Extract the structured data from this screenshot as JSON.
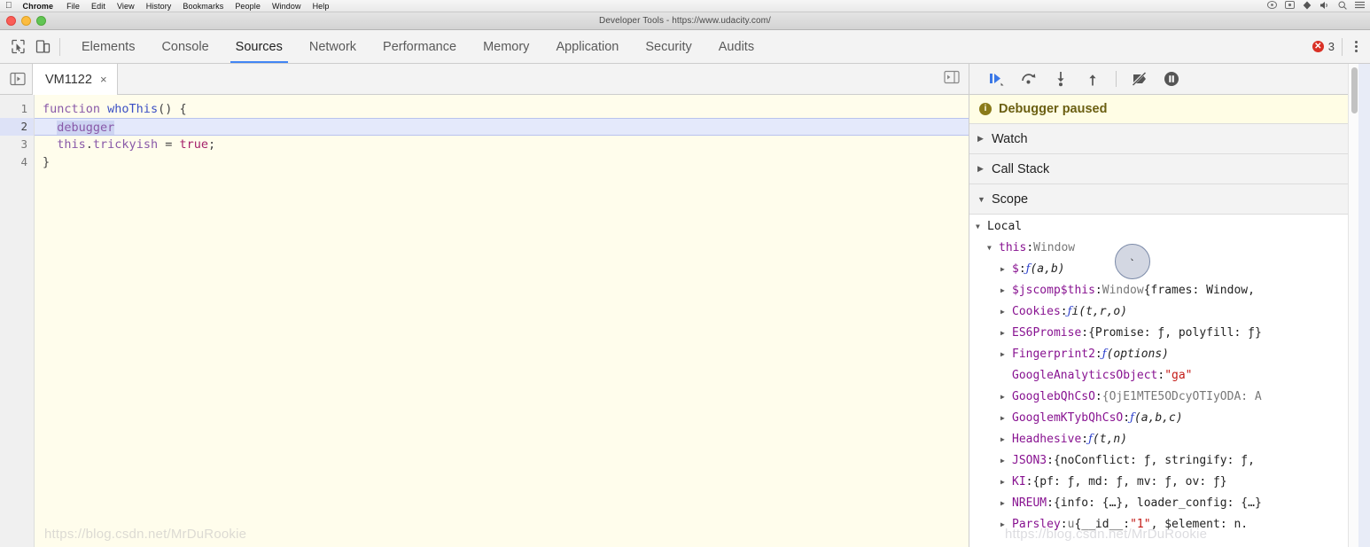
{
  "mac_menubar": {
    "apple": "apple-logo",
    "items": [
      "Chrome",
      "File",
      "Edit",
      "View",
      "History",
      "Bookmarks",
      "People",
      "Window",
      "Help"
    ],
    "status_icons": [
      "screen-share-icon",
      "screen-record-icon",
      "dropbox-icon",
      "volume-icon",
      "search-icon",
      "control-center-icon"
    ]
  },
  "window": {
    "title": "Developer Tools - https://www.udacity.com/"
  },
  "devtools": {
    "inspect_icon": "inspect-element-icon",
    "device_icon": "device-toolbar-icon",
    "tabs": [
      {
        "label": "Elements",
        "active": false
      },
      {
        "label": "Console",
        "active": false
      },
      {
        "label": "Sources",
        "active": true
      },
      {
        "label": "Network",
        "active": false
      },
      {
        "label": "Performance",
        "active": false
      },
      {
        "label": "Memory",
        "active": false
      },
      {
        "label": "Application",
        "active": false
      },
      {
        "label": "Security",
        "active": false
      },
      {
        "label": "Audits",
        "active": false
      }
    ],
    "error_count": "3",
    "error_icon": "error-circle-icon",
    "menu_icon": "kebab-menu-icon",
    "accent_color": "#4285f4",
    "error_color": "#d93025"
  },
  "editor": {
    "nav_toggle_icon": "show-navigator-icon",
    "panel_toggle_icon": "show-debugger-icon",
    "tab": {
      "name": "VM1122",
      "close": "×"
    },
    "line_numbers": [
      "1",
      "2",
      "3",
      "4"
    ],
    "code": {
      "l1_kw": "function",
      "l1_fn": "whoThis",
      "l1_pun": "() {",
      "l2_debugger": "debugger",
      "l3_this": "this",
      "l3_dot": ".",
      "l3_prop": "trickyish",
      "l3_eq": " = ",
      "l3_bool": "true",
      "l3_semi": ";",
      "l4": "}"
    },
    "highlighted_line": "2",
    "background_color": "#fffdec",
    "highlight_color": "#e4e9fb"
  },
  "debugger": {
    "controls": [
      {
        "name": "resume-script-execution",
        "icon": "resume-icon"
      },
      {
        "name": "step-over-next-function-call",
        "icon": "step-over-icon"
      },
      {
        "name": "step-into-next-function-call",
        "icon": "step-into-icon"
      },
      {
        "name": "step-out-of-current-function",
        "icon": "step-out-icon"
      },
      {
        "name": "deactivate-breakpoints",
        "icon": "deactivate-breakpoints-icon"
      },
      {
        "name": "pause-on-exceptions",
        "icon": "pause-on-exceptions-icon"
      }
    ],
    "paused_banner": {
      "icon": "info-icon",
      "text": "Debugger paused"
    },
    "sections": [
      {
        "label": "Watch",
        "expanded": false
      },
      {
        "label": "Call Stack",
        "expanded": false
      },
      {
        "label": "Scope",
        "expanded": true
      }
    ],
    "scope": {
      "local_label": "Local",
      "this_name": "this",
      "this_value": "Window",
      "rows": [
        {
          "arrow": true,
          "name": "$",
          "sep": ": ",
          "fn": "ƒ",
          "args": " (a,b)",
          "val": "",
          "str": ""
        },
        {
          "arrow": true,
          "name": "$jscomp$this",
          "sep": ": ",
          "fn": "",
          "args": "",
          "val": "Window ",
          "txt": "{frames: Window,",
          "str": ""
        },
        {
          "arrow": true,
          "name": "Cookies",
          "sep": ": ",
          "fn": "ƒ",
          "args": " i(t,r,o)",
          "val": "",
          "str": ""
        },
        {
          "arrow": true,
          "name": "ES6Promise",
          "sep": ": ",
          "fn": "",
          "args": "",
          "txt": "{Promise: ƒ, polyfill: ƒ}",
          "str": ""
        },
        {
          "arrow": true,
          "name": "Fingerprint2",
          "sep": ": ",
          "fn": "ƒ",
          "args": " (options)",
          "val": "",
          "str": ""
        },
        {
          "arrow": false,
          "name": "GoogleAnalyticsObject",
          "sep": ": ",
          "fn": "",
          "args": "",
          "str": "\"ga\""
        },
        {
          "arrow": true,
          "name": "GooglebQhCsO",
          "sep": ": ",
          "fn": "",
          "args": "",
          "val": "{OjE1MTE5ODcyOTIyODA: A",
          "str": ""
        },
        {
          "arrow": true,
          "name": "GooglemKTybQhCsO",
          "sep": ": ",
          "fn": "ƒ",
          "args": " (a,b,c)",
          "val": "",
          "str": ""
        },
        {
          "arrow": true,
          "name": "Headhesive",
          "sep": ": ",
          "fn": "ƒ",
          "args": " (t,n)",
          "val": "",
          "str": ""
        },
        {
          "arrow": true,
          "name": "JSON3",
          "sep": ": ",
          "fn": "",
          "args": "",
          "txt": "{noConflict: ƒ, stringify: ƒ,",
          "str": ""
        },
        {
          "arrow": true,
          "name": "KI",
          "sep": ": ",
          "fn": "",
          "args": "",
          "txt": "{pf: ƒ, md: ƒ, mv: ƒ, ov: ƒ}",
          "str": ""
        },
        {
          "arrow": true,
          "name": "NREUM",
          "sep": ": ",
          "fn": "",
          "args": "",
          "txt": "{info: {…}, loader_config: {…}",
          "str": ""
        },
        {
          "arrow": true,
          "name": "Parsley",
          "sep": ": ",
          "fn": "",
          "args": "",
          "val": "u ",
          "txt": "{__id__: ",
          "str": "\"1\"",
          "txt2": ", $element: n."
        }
      ]
    }
  },
  "watermark": {
    "text": "https://blog.csdn.net/MrDuRookie"
  }
}
